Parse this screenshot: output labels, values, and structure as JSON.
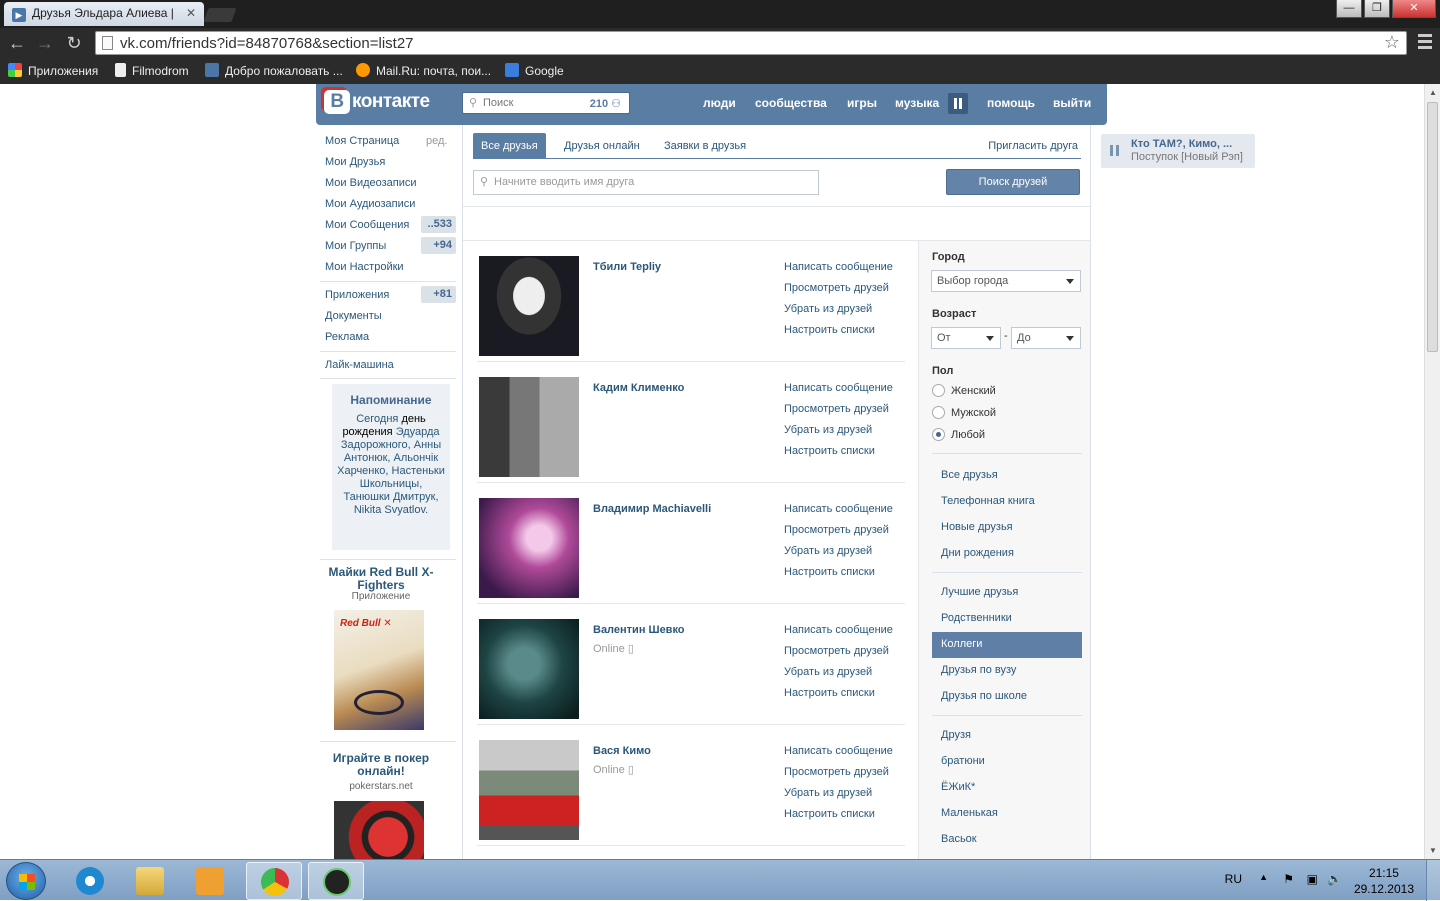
{
  "browser": {
    "tab_title": "Друзья Эльдара Алиева |",
    "url": "vk.com/friends?id=84870768&section=list27",
    "bookmarks": [
      "Приложения",
      "Filmodrom",
      "Добро пожаловать ...",
      "Mail.Ru: почта, пои...",
      "Google"
    ]
  },
  "header": {
    "logo": "контакте",
    "logo_letter": "В",
    "search_placeholder": "Поиск",
    "search_count": "210",
    "nav": [
      "люди",
      "сообщества",
      "игры",
      "музыка",
      "помощь",
      "выйти"
    ]
  },
  "sidebar": {
    "items": [
      {
        "label": "Моя Страница",
        "extra": "ред."
      },
      {
        "label": "Мои Друзья"
      },
      {
        "label": "Мои Видеозаписи"
      },
      {
        "label": "Мои Аудиозаписи"
      },
      {
        "label": "Мои Сообщения",
        "count": "..533"
      },
      {
        "label": "Мои Группы",
        "count": "+94"
      },
      {
        "label": "Мои Настройки"
      },
      {
        "label": "Приложения",
        "count": "+81"
      },
      {
        "label": "Документы"
      },
      {
        "label": "Реклама"
      },
      {
        "label": "Лайк-машина"
      }
    ],
    "reminder": {
      "title": "Напоминание",
      "today": "Сегодня",
      "text": "день рождения",
      "names": "Эдуарда Задорожного, Анны Антонюк, Альончік Харченко, Настеньки Школьницы, Танюшки Дмитрук, Nikita Svyatlov."
    },
    "ads": [
      {
        "title": "Майки Red Bull X-Fighters",
        "sub": "Приложение"
      },
      {
        "title": "Играйте в покер онлайн!",
        "sub": "pokerstars.net"
      }
    ]
  },
  "main": {
    "tabs": [
      "Все друзья",
      "Друзья онлайн",
      "Заявки в друзья"
    ],
    "invite": "Пригласить друга",
    "search_placeholder": "Начните вводить имя друга",
    "find_button": "Поиск друзей",
    "actions": [
      "Написать сообщение",
      "Просмотреть друзей",
      "Убрать из друзей",
      "Настроить списки"
    ],
    "friends": [
      {
        "name": "Тбили Tepliy",
        "status": ""
      },
      {
        "name": "Кадим Клименко",
        "status": ""
      },
      {
        "name": "Владимир Machiavelli",
        "status": ""
      },
      {
        "name": "Валентин Шевко",
        "status": "Online"
      },
      {
        "name": "Вася Кимо",
        "status": "Online"
      }
    ]
  },
  "filters": {
    "city_label": "Город",
    "city_value": "Выбор города",
    "age_label": "Возраст",
    "age_from": "От",
    "age_dash": "-",
    "age_to": "До",
    "sex_label": "Пол",
    "sex_options": [
      "Женский",
      "Мужской",
      "Любой"
    ],
    "sex_selected": "Любой",
    "lists_a": [
      "Все друзья",
      "Телефонная книга",
      "Новые друзья",
      "Дни рождения"
    ],
    "lists_b": [
      "Лучшие друзья",
      "Родственники",
      "Коллеги",
      "Друзья по вузу",
      "Друзья по школе"
    ],
    "lists_c": [
      "Друзя",
      "братюни",
      "ЁЖиК*",
      "Маленькая",
      "Васьок"
    ],
    "active_list": "Коллеги"
  },
  "player": {
    "title": "Кто ТАМ?, Кимо, ...",
    "track": "Поступок [Новый Рэп]"
  },
  "taskbar": {
    "lang": "RU",
    "time": "21:15",
    "date": "29.12.2013"
  },
  "colors": {
    "vk_blue": "#597da3",
    "link": "#2b587a",
    "active_list": "#5f7fa6"
  }
}
